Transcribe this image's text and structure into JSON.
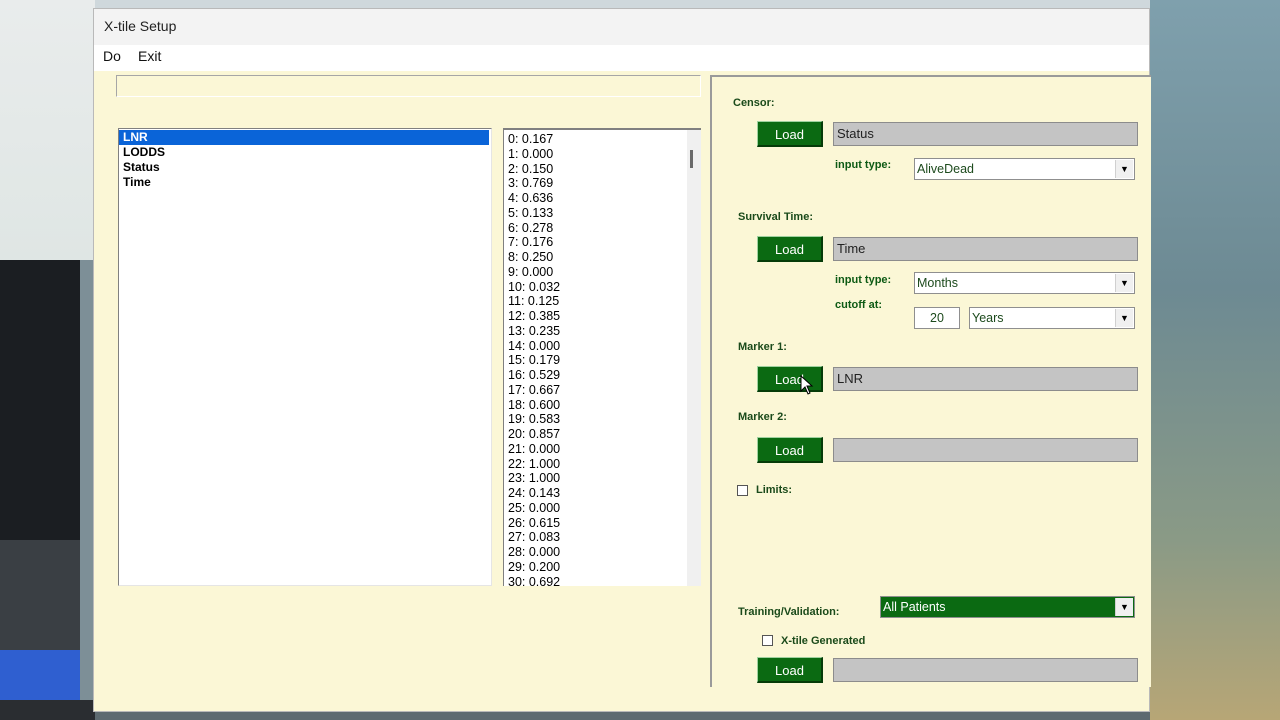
{
  "window": {
    "title": "X-tile Setup"
  },
  "menu": [
    "Do",
    "Exit"
  ],
  "variables": [
    "LNR",
    "LODDS",
    "Status",
    "Time"
  ],
  "values": [
    "0: 0.167",
    "1: 0.000",
    "2: 0.150",
    "3: 0.769",
    "4: 0.636",
    "5: 0.133",
    "6: 0.278",
    "7: 0.176",
    "8: 0.250",
    "9: 0.000",
    "10: 0.032",
    "11: 0.125",
    "12: 0.385",
    "13: 0.235",
    "14: 0.000",
    "15: 0.179",
    "16: 0.529",
    "17: 0.667",
    "18: 0.600",
    "19: 0.583",
    "20: 0.857",
    "21: 0.000",
    "22: 1.000",
    "23: 1.000",
    "24: 0.143",
    "25: 0.000",
    "26: 0.615",
    "27: 0.083",
    "28: 0.000",
    "29: 0.200",
    "30: 0.692"
  ],
  "censor": {
    "label": "Censor:",
    "load": "Load",
    "value": "Status",
    "input_type_label": "input type:",
    "input_type": "AliveDead"
  },
  "survival": {
    "label": "Survival Time:",
    "load": "Load",
    "value": "Time",
    "input_type_label": "input type:",
    "input_type": "Months",
    "cutoff_label": "cutoff at:",
    "cutoff_value": "20",
    "cutoff_unit": "Years"
  },
  "marker1": {
    "label": "Marker 1:",
    "load": "Load",
    "value": "LNR"
  },
  "marker2": {
    "label": "Marker 2:",
    "load": "Load",
    "value": ""
  },
  "limits": {
    "label": "Limits:"
  },
  "training": {
    "label": "Training/Validation:",
    "value": "All Patients",
    "xtile_label": "X-tile Generated",
    "load": "Load",
    "value_field": ""
  },
  "colors": {
    "button": "#0b6a12",
    "panel_bg": "#fbf7d6",
    "selection": "#0a64d8"
  }
}
